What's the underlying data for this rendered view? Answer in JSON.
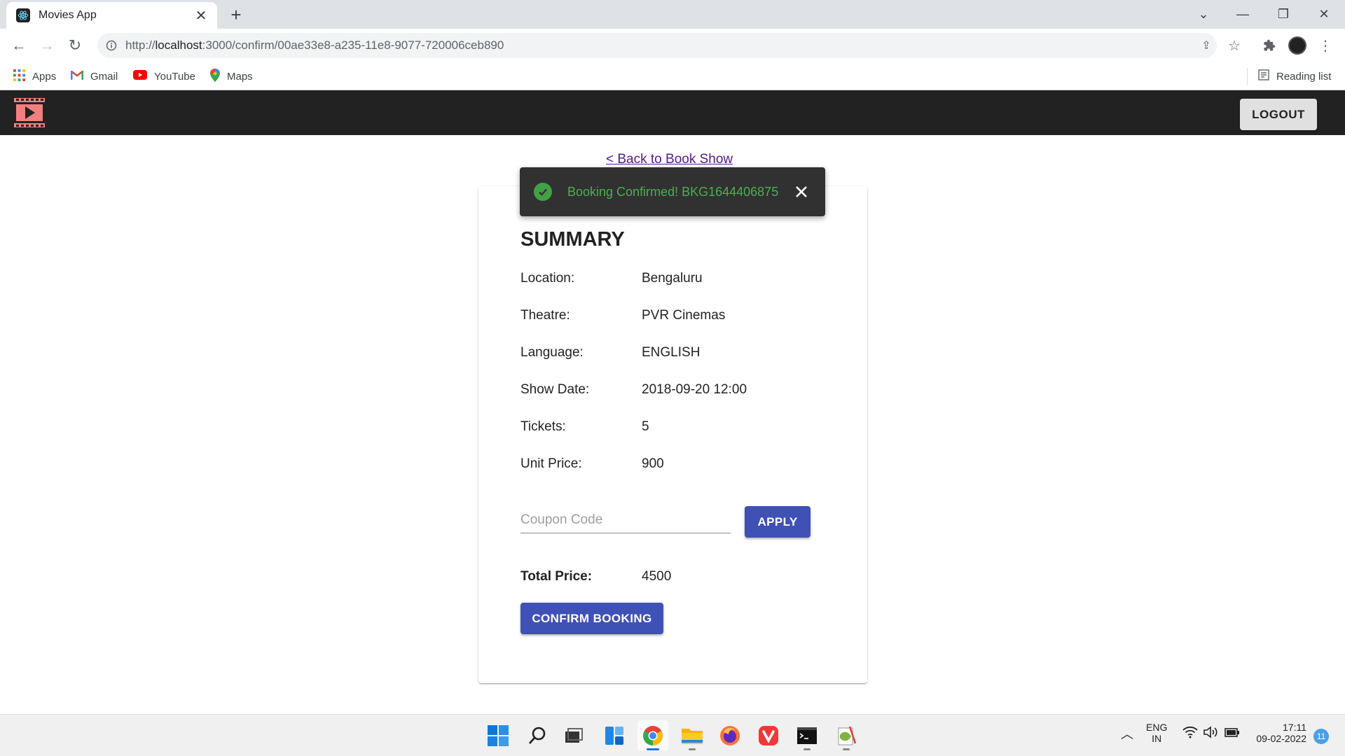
{
  "browser": {
    "tab_title": "Movies App",
    "new_tab": "+",
    "url_prefix": "http://",
    "url_host": "localhost",
    "url_rest": ":3000/confirm/00ae33e8-a235-11e8-9077-720006ceb890",
    "bookmarks": [
      {
        "label": "Apps",
        "icon": "apps-grid-icon"
      },
      {
        "label": "Gmail",
        "icon": "gmail-icon"
      },
      {
        "label": "YouTube",
        "icon": "youtube-icon"
      },
      {
        "label": "Maps",
        "icon": "maps-icon"
      }
    ],
    "reading_list": "Reading list"
  },
  "app": {
    "logout_label": "LOGOUT",
    "back_link": "< Back to Book Show",
    "snackbar": {
      "message": "Booking Confirmed! BKG1644406875"
    },
    "summary": {
      "title": "SUMMARY",
      "rows": [
        {
          "label": "Location:",
          "value": "Bengaluru"
        },
        {
          "label": "Theatre:",
          "value": "PVR Cinemas"
        },
        {
          "label": "Language:",
          "value": "ENGLISH"
        },
        {
          "label": "Show Date:",
          "value": "2018-09-20 12:00"
        },
        {
          "label": "Tickets:",
          "value": "5"
        },
        {
          "label": "Unit Price:",
          "value": "900"
        }
      ],
      "coupon_placeholder": "Coupon Code",
      "apply_label": "APPLY",
      "total_label": "Total Price:",
      "total_value": "4500",
      "confirm_label": "CONFIRM BOOKING"
    },
    "colors": {
      "primary": "#3f51b5",
      "header": "#222222",
      "success": "#4caf50"
    }
  },
  "taskbar": {
    "lang_line1": "ENG",
    "lang_line2": "IN",
    "time": "17:11",
    "date": "09-02-2022",
    "notification_count": "11"
  }
}
